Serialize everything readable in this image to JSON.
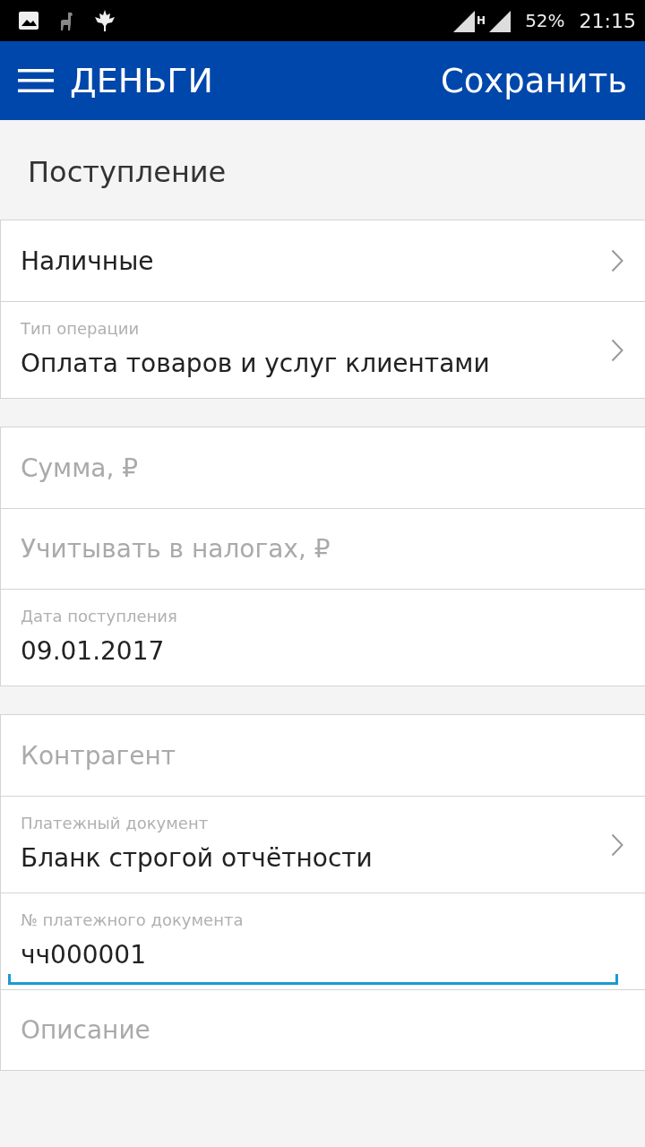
{
  "status_bar": {
    "network": "H",
    "battery": "52%",
    "time": "21:15"
  },
  "app_bar": {
    "title": "ДЕНЬГИ",
    "action": "Сохранить"
  },
  "section_title": "Поступление",
  "groups": [
    [
      {
        "kind": "select",
        "value": "Наличные"
      },
      {
        "kind": "select",
        "label": "Тип операции",
        "value": "Оплата товаров и услуг клиентами"
      }
    ],
    [
      {
        "kind": "input",
        "placeholder": "Сумма, ₽",
        "focused": false
      },
      {
        "kind": "input",
        "placeholder": "Учитывать в налогах, ₽",
        "focused": false
      },
      {
        "kind": "input",
        "label": "Дата поступления",
        "value": "09.01.2017",
        "focused": false
      }
    ],
    [
      {
        "kind": "input",
        "placeholder": "Контрагент",
        "focused": false
      },
      {
        "kind": "select",
        "label": "Платежный документ",
        "value": "Бланк строгой отчётности"
      },
      {
        "kind": "input",
        "label": "№ платежного документа",
        "value": "чч000001",
        "focused": true
      },
      {
        "kind": "input",
        "placeholder": "Описание",
        "focused": false
      }
    ]
  ]
}
